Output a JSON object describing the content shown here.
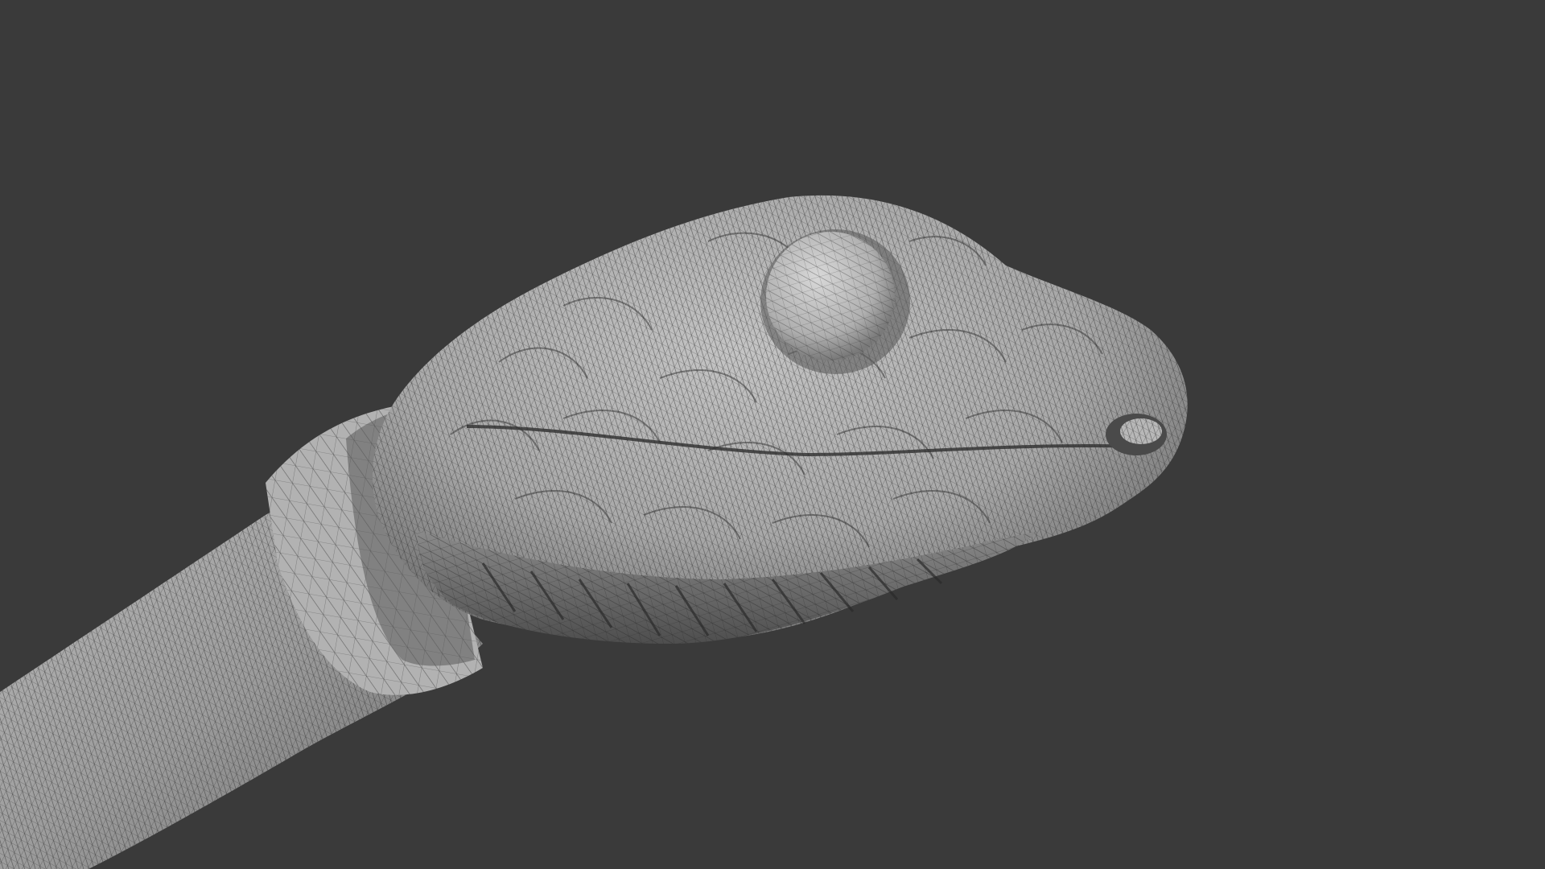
{
  "viewport": {
    "background_color": "#3a3a3a",
    "mesh_fill_color": "#a8a8a8",
    "mesh_highlight_color": "#c4c4c4",
    "mesh_shadow_color": "#6e6e6e",
    "wire_color": "#2a2a2a",
    "subject": "snake-head-mesh"
  }
}
